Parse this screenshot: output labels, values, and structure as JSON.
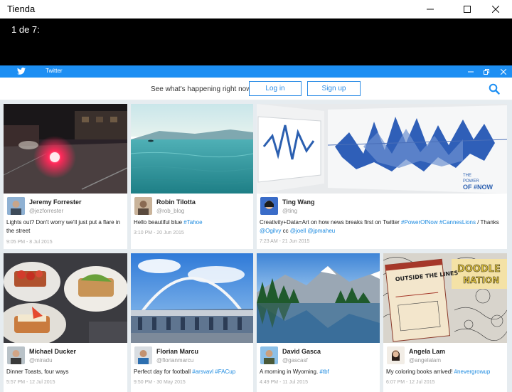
{
  "window": {
    "title": "Tienda"
  },
  "viewer": {
    "counter": "1 de 7:"
  },
  "twitter_app": {
    "title": "Twitter"
  },
  "header": {
    "tagline": "See what's happening right now.",
    "login_label": "Log in",
    "signup_label": "Sign up"
  },
  "colors": {
    "twitter_blue": "#1d8ff3",
    "link": "#1b8ae0",
    "background": "#e6ecf0"
  },
  "tweets": [
    {
      "name": "Jeremy Forrester",
      "handle": "@jezforrester",
      "text": "Lights out? Don't worry we'll just put a flare in the street",
      "hashtags": "",
      "time": "9:05 PM - 8 Jul 2015"
    },
    {
      "name": "Robin Tilotta",
      "handle": "@rob_blog",
      "text": "Hello beautiful blue ",
      "hashtags": "#Tahoe",
      "time": "3:10 PM - 20 Jun 2015"
    },
    {
      "name": "Ting Wang",
      "handle": "@ting",
      "text_parts": [
        "Creativity+Data=Art on how news breaks first on Twitter ",
        "#PowerOfNow",
        " ",
        "#CannesLions",
        " / Thanks ",
        "@Ogilvy",
        " cc ",
        "@joell",
        " ",
        "@jpmaheu"
      ],
      "time": "7:23 AM - 21 Jun 2015"
    },
    {
      "name": "Michael Ducker",
      "handle": "@miradu",
      "text": "Dinner Toasts, four ways",
      "hashtags": "",
      "time": "5:57 PM - 12 Jul 2015"
    },
    {
      "name": "Florian Marcu",
      "handle": "@florianmarcu",
      "text": "Perfect day for football ",
      "hashtags": "#arsvavl #FACup",
      "time": "9:50 PM - 30 May 2015"
    },
    {
      "name": "David Gasca",
      "handle": "@gascasf",
      "text": "A morning in Wyoming. ",
      "hashtags": "#tbf",
      "time": "4:49 PM - 11 Jul 2015"
    },
    {
      "name": "Angela Lam",
      "handle": "@angelalam",
      "text": "My coloring books arrived! ",
      "hashtags": "#nevergrowup",
      "time": "6:07 PM - 12 Jul 2015"
    }
  ],
  "book_cover": {
    "title": "OUTSIDE THE LINES"
  }
}
